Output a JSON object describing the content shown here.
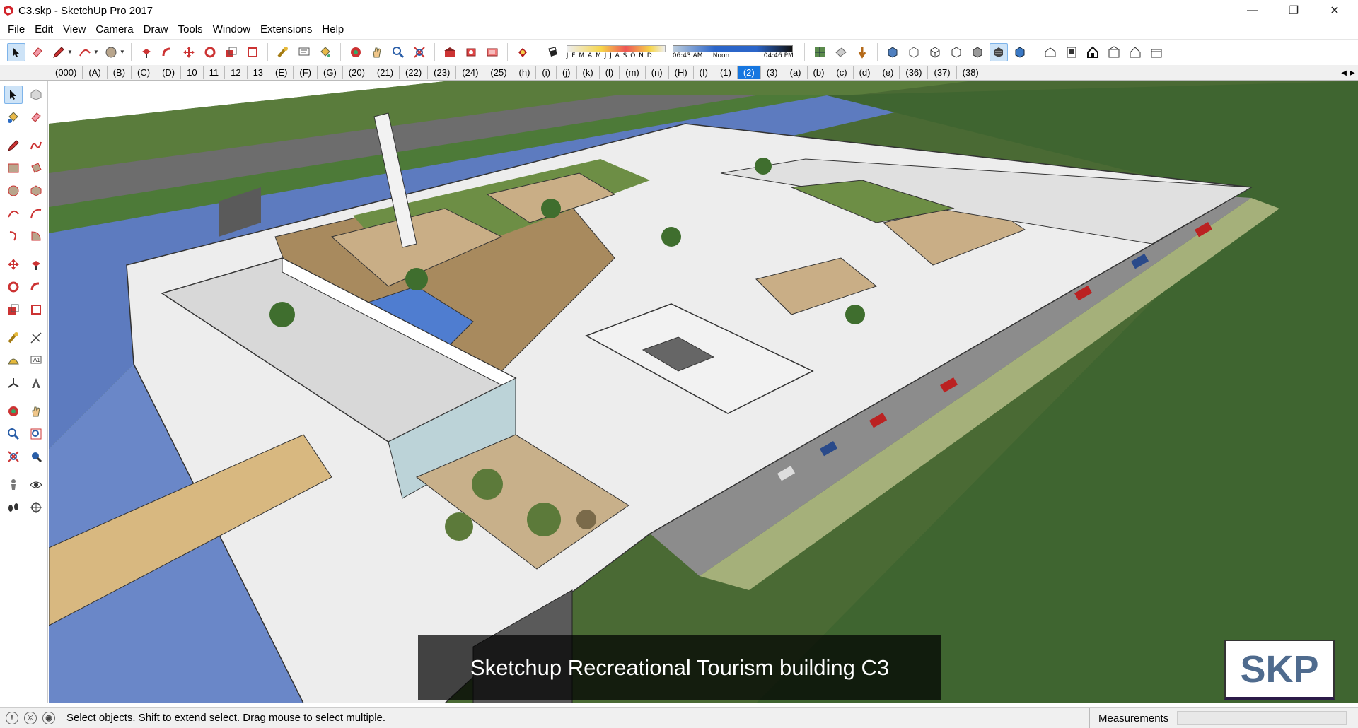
{
  "window": {
    "title": "C3.skp - SketchUp Pro 2017",
    "controls": [
      "—",
      "❐",
      "✕"
    ]
  },
  "menu": [
    "File",
    "Edit",
    "View",
    "Camera",
    "Draw",
    "Tools",
    "Window",
    "Extensions",
    "Help"
  ],
  "shadow_settings": {
    "months": "J F M A M J J A S O N D",
    "time_start": "06:43 AM",
    "time_mid": "Noon",
    "time_end": "04:46 PM"
  },
  "scene_tabs": [
    "(000)",
    "(A)",
    "(B)",
    "(C)",
    "(D)",
    "10",
    "11",
    "12",
    "13",
    "(E)",
    "(F)",
    "(G)",
    "(20)",
    "(21)",
    "(22)",
    "(23)",
    "(24)",
    "(25)",
    "(h)",
    "(i)",
    "(j)",
    "(k)",
    "(l)",
    "(m)",
    "(n)",
    "(H)",
    "(I)",
    "(1)",
    "(2)",
    "(3)",
    "(a)",
    "(b)",
    "(c)",
    "(d)",
    "(e)",
    "(36)",
    "(37)",
    "(38)"
  ],
  "active_scene": "(2)",
  "viewport": {
    "caption": "Sketchup Recreational Tourism building C3",
    "watermark": "SKP"
  },
  "statusbar": {
    "message": "Select objects. Shift to extend select. Drag mouse to select multiple.",
    "measurements_label": "Measurements",
    "measurements_value": ""
  },
  "colors": {
    "ground": "#4a6a34",
    "water": "#5d7bbf",
    "road": "#6d6d6d",
    "roof": "#d8d8d8",
    "deck": "#a88a5e",
    "active_tab": "#1777e0"
  }
}
